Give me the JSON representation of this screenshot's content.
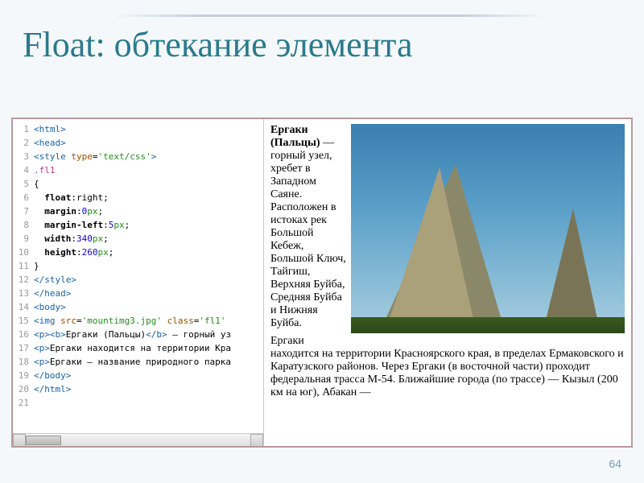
{
  "slide": {
    "title": "Float: обтекание элемента",
    "page_number": "64"
  },
  "code": {
    "lines": [
      {
        "n": 1,
        "html": "<span class='tag'>&lt;html&gt;</span>"
      },
      {
        "n": 2,
        "html": "<span class='tag'>&lt;head&gt;</span>"
      },
      {
        "n": 3,
        "html": "<span class='tag'>&lt;style</span> <span class='attr'>type</span>=<span class='str'>'text/css'</span><span class='tag'>&gt;</span>"
      },
      {
        "n": 4,
        "html": "<span class='sel'>.fl1</span>"
      },
      {
        "n": 5,
        "html": "{"
      },
      {
        "n": 6,
        "html": "  <span class='prop'>float</span>:right;"
      },
      {
        "n": 7,
        "html": "  <span class='prop'>margin</span>:<span class='num'>0</span><span class='unit'>px</span>;"
      },
      {
        "n": 8,
        "html": "  <span class='prop'>margin-left</span>:<span class='num'>5</span><span class='unit'>px</span>;"
      },
      {
        "n": 9,
        "html": "  <span class='prop'>width</span>:<span class='num'>340</span><span class='unit'>px</span>;"
      },
      {
        "n": 10,
        "html": "  <span class='prop'>height</span>:<span class='num'>260</span><span class='unit'>px</span>;"
      },
      {
        "n": 11,
        "html": "}"
      },
      {
        "n": 12,
        "html": "<span class='tag'>&lt;/style&gt;</span>"
      },
      {
        "n": 13,
        "html": "<span class='tag'>&lt;/head&gt;</span>"
      },
      {
        "n": 14,
        "html": "<span class='tag'>&lt;body&gt;</span>"
      },
      {
        "n": 15,
        "html": "<span class='tag'>&lt;img</span> <span class='attr'>src</span>=<span class='str'>'mountimg3.jpg'</span> <span class='attr'>class</span>=<span class='str'>'fl1'</span>"
      },
      {
        "n": 16,
        "html": "<span class='tag'>&lt;p&gt;&lt;b&gt;</span>Ергаки (Пальцы)<span class='tag'>&lt;/b&gt;</span> — горный уз"
      },
      {
        "n": 17,
        "html": "<span class='tag'>&lt;p&gt;</span>Ергаки находится на территории Кра"
      },
      {
        "n": 18,
        "html": "<span class='tag'>&lt;p&gt;</span>Ергаки — название природного парка"
      },
      {
        "n": 19,
        "html": "<span class='tag'>&lt;/body&gt;</span>"
      },
      {
        "n": 20,
        "html": "<span class='tag'>&lt;/html&gt;</span>"
      },
      {
        "n": 21,
        "html": ""
      }
    ]
  },
  "preview": {
    "bold_title": "Ергаки (Пальцы)",
    "para1_rest": " — горный узел, хребет в Западном Саяне. Расположен в истоках рек Большой Кебеж, Большой Ключ, Тайгиш, Верхняя Буйба, Средняя Буйба и Нижняя Буйба.",
    "para2": "Ергаки находится на территории Красноярского края, в пределах Ермаковского и Каратузского районов. Через Ергаки (в восточной части) проходит федеральная трасса М-54. Ближайшие города (по трассе) — Кызыл (200 км на юг), Абакан —"
  }
}
